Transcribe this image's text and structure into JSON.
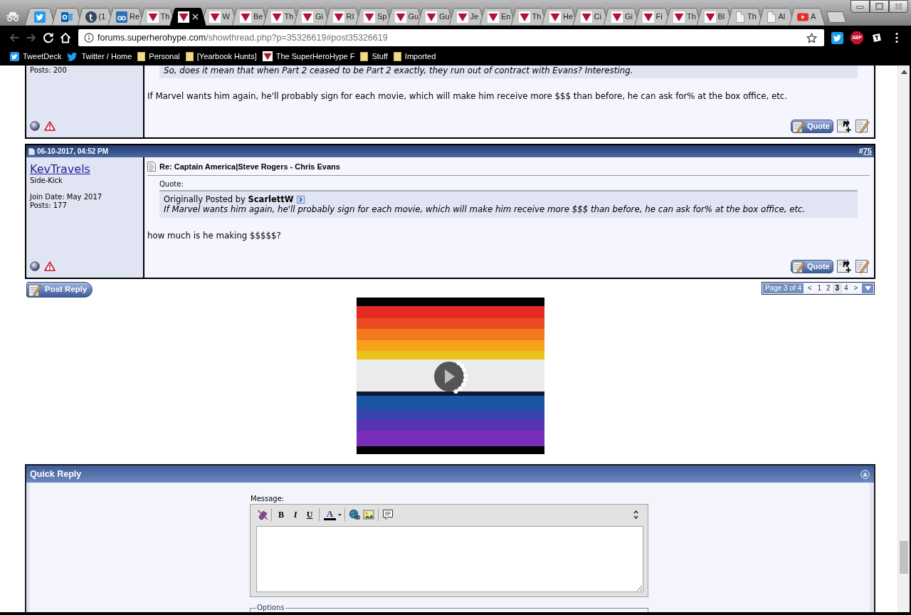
{
  "browser": {
    "tabs": [
      {
        "kind": "bird",
        "pinned": true,
        "selected": false
      },
      {
        "kind": "mail",
        "pinned": true,
        "selected": false
      },
      {
        "kind": "circle",
        "pinned": false,
        "selected": false,
        "title": "(1"
      },
      {
        "kind": "square",
        "pinned": false,
        "selected": false,
        "title": "Re"
      },
      {
        "kind": "site",
        "pinned": false,
        "selected": false,
        "title": "Th"
      },
      {
        "kind": "site",
        "pinned": false,
        "selected": true
      },
      {
        "kind": "site",
        "pinned": false,
        "selected": false,
        "title": "W"
      },
      {
        "kind": "site",
        "pinned": false,
        "selected": false,
        "title": "Be"
      },
      {
        "kind": "site",
        "pinned": false,
        "selected": false,
        "title": "Th"
      },
      {
        "kind": "site",
        "pinned": false,
        "selected": false,
        "title": "Gi"
      },
      {
        "kind": "site",
        "pinned": false,
        "selected": false,
        "title": "RI"
      },
      {
        "kind": "site",
        "pinned": false,
        "selected": false,
        "title": "Sp"
      },
      {
        "kind": "site",
        "pinned": false,
        "selected": false,
        "title": "Gu"
      },
      {
        "kind": "site",
        "pinned": false,
        "selected": false,
        "title": "Gu"
      },
      {
        "kind": "site",
        "pinned": false,
        "selected": false,
        "title": "Je"
      },
      {
        "kind": "site",
        "pinned": false,
        "selected": false,
        "title": "En"
      },
      {
        "kind": "site",
        "pinned": false,
        "selected": false,
        "title": "Th"
      },
      {
        "kind": "site",
        "pinned": false,
        "selected": false,
        "title": "He"
      },
      {
        "kind": "site",
        "pinned": false,
        "selected": false,
        "title": "Ci"
      },
      {
        "kind": "site",
        "pinned": false,
        "selected": false,
        "title": "Gi"
      },
      {
        "kind": "site",
        "pinned": false,
        "selected": false,
        "title": "Fi"
      },
      {
        "kind": "site",
        "pinned": false,
        "selected": false,
        "title": "Th"
      },
      {
        "kind": "site",
        "pinned": false,
        "selected": false,
        "title": "Bl"
      },
      {
        "kind": "page",
        "pinned": false,
        "selected": false,
        "title": "Th"
      },
      {
        "kind": "page",
        "pinned": false,
        "selected": false,
        "title": "Al"
      },
      {
        "kind": "video",
        "pinned": false,
        "selected": false,
        "title": "A"
      }
    ],
    "navigation": {
      "back_disabled": true,
      "forward_disabled": true
    },
    "address": {
      "domain": "forums.superherohype.com",
      "path": "/showthread.php?p=35326619#post35326619"
    },
    "extensions": [
      {
        "kind": "bird"
      },
      {
        "kind": "adblock",
        "label": "ABP"
      },
      {
        "kind": "tile"
      }
    ],
    "bookmarks": [
      {
        "kind": "app",
        "label": "TweetDeck"
      },
      {
        "kind": "bird",
        "label": "Twitter / Home"
      },
      {
        "kind": "folder",
        "label": "Personal"
      },
      {
        "kind": "folder",
        "label": "[Yearbook Hunts]"
      },
      {
        "kind": "site",
        "label": "The SuperHeroHype F"
      },
      {
        "kind": "folder",
        "label": "Stuff"
      },
      {
        "kind": "folder",
        "label": "Imported"
      }
    ]
  },
  "thread": {
    "posts": [
      {
        "user": {
          "post_count": "Posts: 200"
        },
        "quote": {
          "text": "So, does it mean that when Part 2 ceased to be Part 2 exactly, they run out of contract with Evans? Interesting."
        },
        "message": "If Marvel wants him again, he'll probably sign for each movie, which will make him receive more $$$ than before, he can ask for% at the box office, etc.",
        "online": false,
        "actions": [
          {
            "kind": "quote",
            "label": "Quote"
          },
          {
            "kind": "multiquote"
          },
          {
            "kind": "edit"
          }
        ]
      },
      {
        "date": "06-10-2017, 04:52 PM",
        "number_prefix": "#",
        "number": "75",
        "user": {
          "name": "KevTravels",
          "rank": "Side-Kick",
          "join_date": "Join Date: May 2017",
          "post_count": "Posts: 177"
        },
        "title": "Re: Captain America|Steve Rogers - Chris Evans",
        "quote": {
          "label": "Quote:",
          "byline": "Originally Posted by **ScarlettW**",
          "text": "If Marvel wants him again, he'll probably sign for each movie, which will make him receive more $$$ than before, he can ask for% at the box office, etc."
        },
        "message": "how much is he making $$$$$?",
        "online": false,
        "actions": [
          {
            "kind": "quote",
            "label": "Quote"
          },
          {
            "kind": "multiquote"
          },
          {
            "kind": "edit"
          }
        ]
      }
    ]
  },
  "post_reply": {
    "label": "Post Reply"
  },
  "pagination": {
    "summary": "Page 3 of 4",
    "previous": "<",
    "pages": [
      {
        "label": "1",
        "selected": false
      },
      {
        "label": "2",
        "selected": false
      },
      {
        "label": "3",
        "selected": true
      },
      {
        "label": "4",
        "selected": false
      }
    ],
    "next": ">"
  },
  "ad": {
    "kind": "video"
  },
  "quick_reply": {
    "title": "Quick Reply",
    "expanded": true,
    "message_label": "Message:",
    "toolbar": [
      [
        {
          "kind": "clear"
        }
      ],
      [
        {
          "kind": "bold",
          "label": "B"
        },
        {
          "kind": "italic",
          "label": "I"
        },
        {
          "kind": "underline",
          "label": "U"
        }
      ],
      [
        {
          "kind": "color",
          "label": "A"
        }
      ],
      [
        {
          "kind": "link"
        },
        {
          "kind": "image"
        }
      ],
      [
        {
          "kind": "quote"
        }
      ]
    ],
    "options_legend": "Options"
  }
}
